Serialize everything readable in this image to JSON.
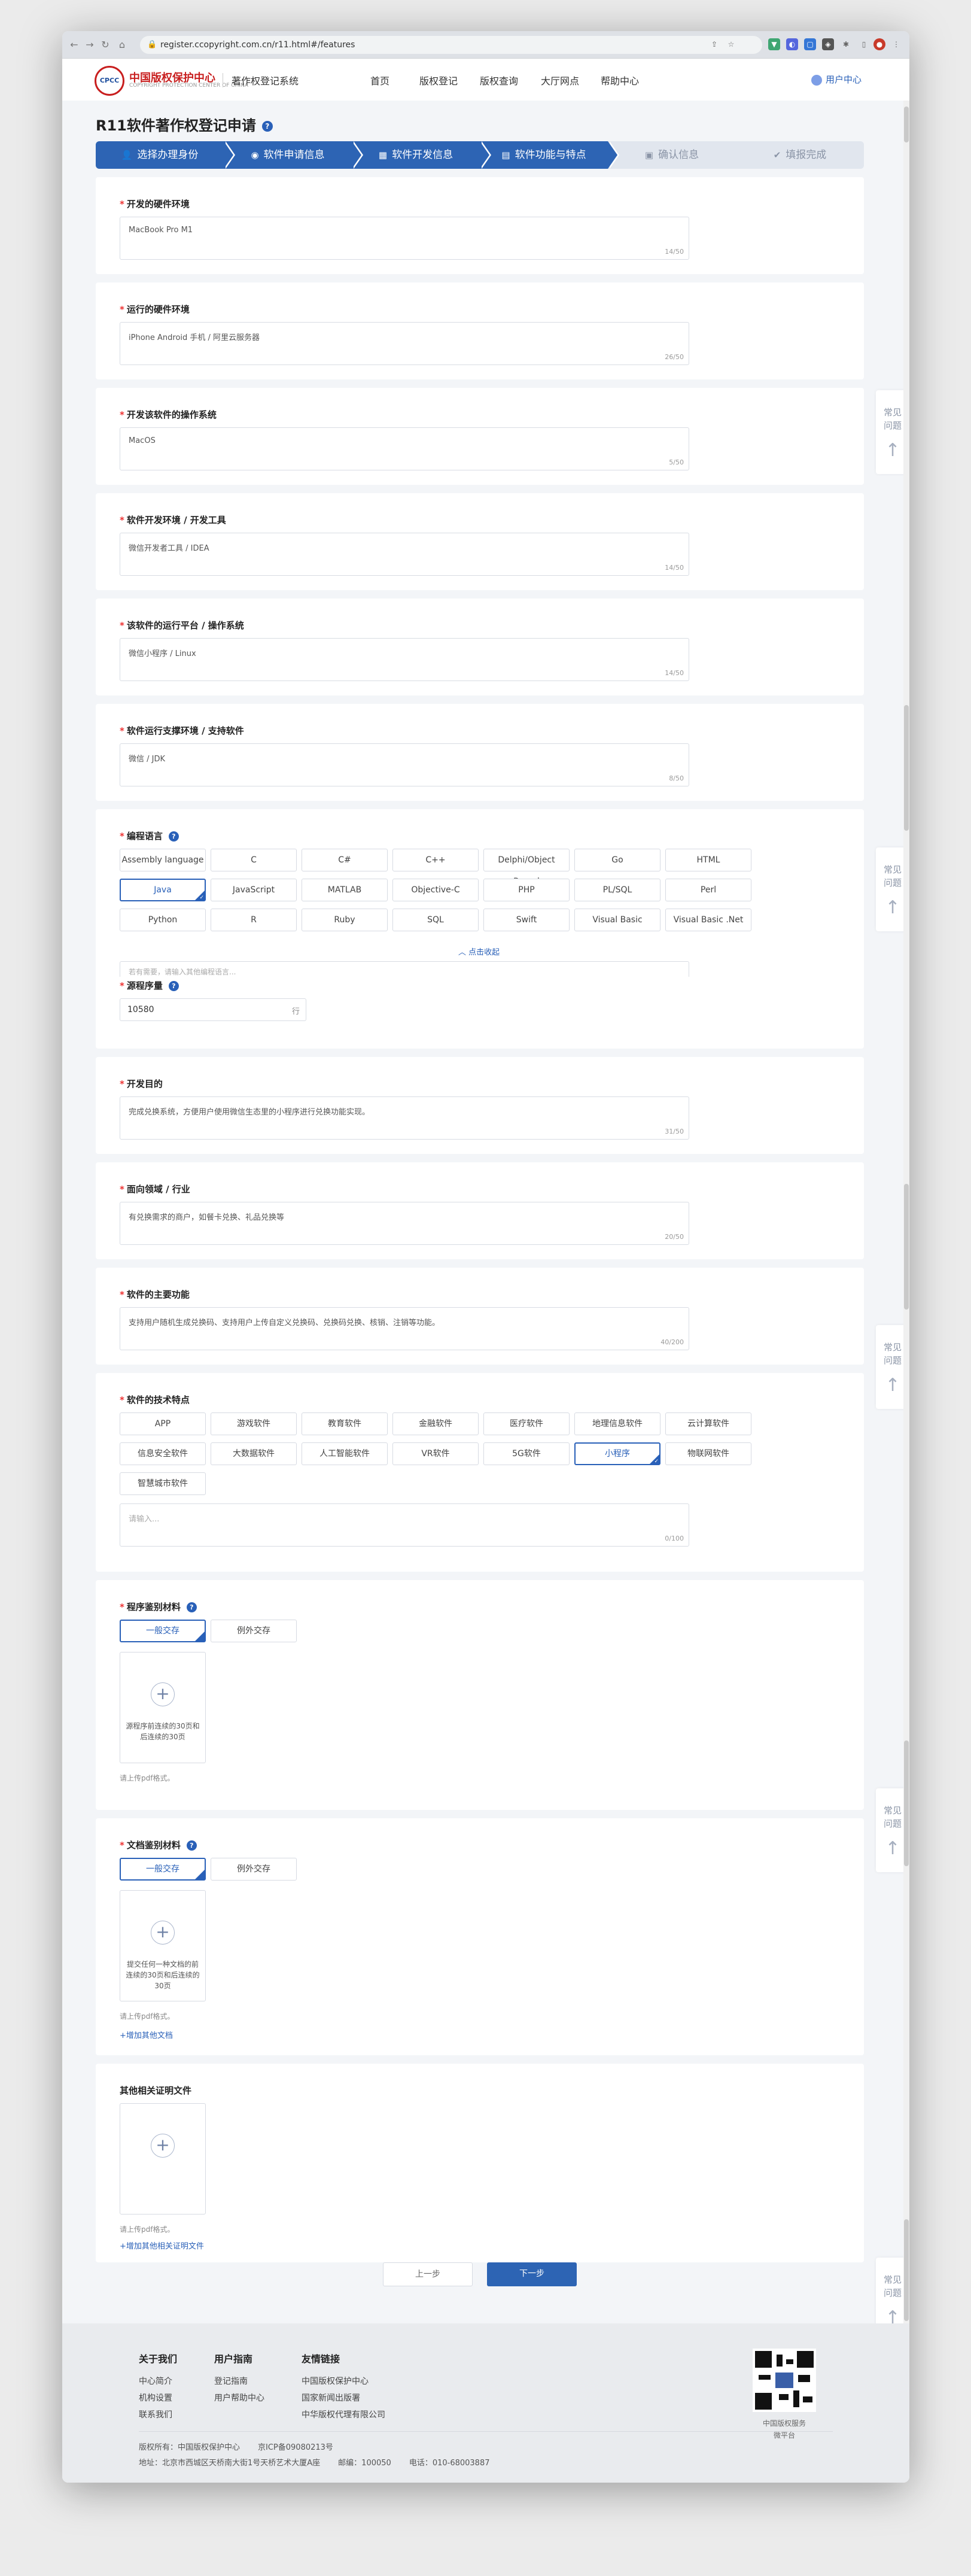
{
  "browser": {
    "url": "register.ccopyright.com.cn/r11.html#/features"
  },
  "header": {
    "logo_main": "中国版权保护中心",
    "logo_sub": "COPYRIGHT PROTECTION CENTER OF CHINA",
    "system": "著作权登记系统",
    "nav": [
      "首页",
      "版权登记",
      "版权查询",
      "大厅网点",
      "帮助中心"
    ],
    "user": "用户中心"
  },
  "page": {
    "title": "R11软件著作权登记申请"
  },
  "steps": [
    "选择办理身份",
    "软件申请信息",
    "软件开发信息",
    "软件功能与特点",
    "确认信息",
    "填报完成"
  ],
  "fields": {
    "dev_hw": {
      "label": "开发的硬件环境",
      "value": "MacBook Pro M1",
      "count": "14/50"
    },
    "run_hw": {
      "label": "运行的硬件环境",
      "value": "iPhone Android 手机 / 阿里云服务器",
      "count": "26/50"
    },
    "dev_os": {
      "label": "开发该软件的操作系统",
      "value": "MacOS",
      "count": "5/50"
    },
    "dev_tools": {
      "label": "软件开发环境 / 开发工具",
      "value": "微信开发者工具 / IDEA",
      "count": "14/50"
    },
    "run_platform": {
      "label": "该软件的运行平台 / 操作系统",
      "value": "微信小程序 / Linux",
      "count": "14/50"
    },
    "support_sw": {
      "label": "软件运行支撑环境 / 支持软件",
      "value": "微信 / JDK",
      "count": "8/50"
    },
    "purpose": {
      "label": "开发目的",
      "value": "完成兑换系统，方便用户使用微信生态里的小程序进行兑换功能实现。",
      "count": "31/50"
    },
    "domain": {
      "label": "面向领域 / 行业",
      "value": "有兑换需求的商户，如餐卡兑换、礼品兑换等",
      "count": "20/50"
    },
    "main_func": {
      "label": "软件的主要功能",
      "value": "支持用户随机生成兑换码、支持用户上传自定义兑换码、兑换码兑换、核销、注销等功能。",
      "count": "40/200"
    }
  },
  "lang": {
    "label": "编程语言",
    "items": [
      "Assembly language",
      "C",
      "C#",
      "C++",
      "Delphi/Object Pascal",
      "Go",
      "HTML",
      "Java",
      "JavaScript",
      "MATLAB",
      "Objective-C",
      "PHP",
      "PL/SQL",
      "Perl",
      "Python",
      "R",
      "Ruby",
      "SQL",
      "Swift",
      "Visual Basic",
      "Visual Basic .Net"
    ],
    "selected": "Java",
    "collapse": "点击收起",
    "other_ph": "若有需要，请输入其他编程语言..."
  },
  "loc": {
    "label": "源程序量",
    "value": "10580",
    "unit": "行"
  },
  "tech": {
    "label": "软件的技术特点",
    "items": [
      "APP",
      "游戏软件",
      "教育软件",
      "金融软件",
      "医疗软件",
      "地理信息软件",
      "云计算软件",
      "信息安全软件",
      "大数据软件",
      "人工智能软件",
      "VR软件",
      "5G软件",
      "小程序",
      "物联网软件",
      "智慧城市软件"
    ],
    "selected": "小程序",
    "ph": "请输入...",
    "count": "0/100"
  },
  "prog_mat": {
    "label": "程序鉴别材料",
    "tabs": [
      "一般交存",
      "例外交存"
    ],
    "upload": "源程序前连续的30页和后连续的30页",
    "hint": "请上传pdf格式。"
  },
  "doc_mat": {
    "label": "文档鉴别材料",
    "tabs": [
      "一般交存",
      "例外交存"
    ],
    "upload": "提交任何一种文档的前连续的30页和后连续的30页",
    "hint": "请上传pdf格式。",
    "add": "+增加其他文档"
  },
  "other": {
    "label": "其他相关证明文件",
    "hint": "请上传pdf格式。",
    "add": "+增加其他相关证明文件"
  },
  "actions": {
    "prev": "上一步",
    "next": "下一步"
  },
  "faq": {
    "line1": "常见",
    "line2": "问题"
  },
  "footer": {
    "about": {
      "title": "关于我们",
      "links": [
        "中心简介",
        "机构设置",
        "联系我们"
      ]
    },
    "guide": {
      "title": "用户指南",
      "links": [
        "登记指南",
        "用户帮助中心"
      ]
    },
    "friends": {
      "title": "友情链接",
      "links": [
        "中国版权保护中心",
        "国家新闻出版署",
        "中华版权代理有限公司"
      ]
    },
    "qr_caption1": "中国版权服务",
    "qr_caption2": "微平台",
    "copyright": "版权所有：中国版权保护中心",
    "icp": "京ICP备09080213号",
    "address": "地址：北京市西城区天桥南大街1号天桥艺术大厦A座",
    "zip": "邮编：100050",
    "tel": "电话：010-68003887"
  }
}
